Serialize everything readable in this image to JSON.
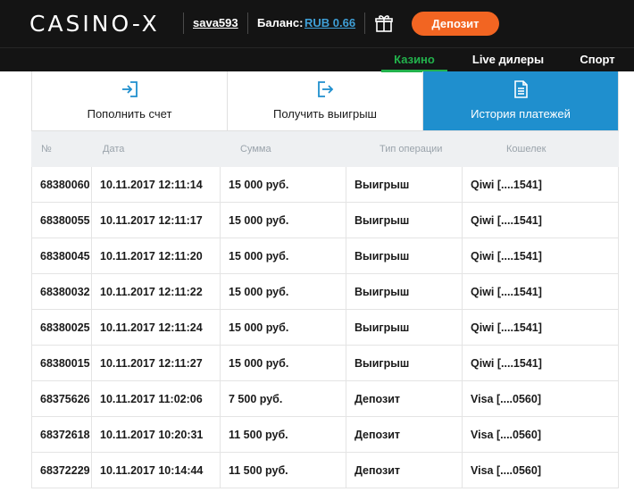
{
  "header": {
    "logo": "CASINO-X",
    "username": "sava593",
    "balance_label": "Баланс:",
    "balance_value": "RUB 0.66",
    "deposit_label": "Депозит"
  },
  "nav": [
    {
      "label": "Казино",
      "active": true
    },
    {
      "label": "Live дилеры",
      "active": false
    },
    {
      "label": "Спорт",
      "active": false
    }
  ],
  "actions": [
    {
      "label": "Пополнить счет",
      "icon": "login-icon",
      "active": false
    },
    {
      "label": "Получить выигрыш",
      "icon": "logout-icon",
      "active": false
    },
    {
      "label": "История платежей",
      "icon": "document-icon",
      "active": true
    }
  ],
  "table": {
    "headers": [
      "№",
      "Дата",
      "Сумма",
      "Тип операции",
      "Кошелек"
    ],
    "rows": [
      [
        "68380060",
        "10.11.2017 12:11:14",
        "15 000 руб.",
        "Выигрыш",
        "Qiwi [....1541]"
      ],
      [
        "68380055",
        "10.11.2017 12:11:17",
        "15 000 руб.",
        "Выигрыш",
        "Qiwi [....1541]"
      ],
      [
        "68380045",
        "10.11.2017 12:11:20",
        "15 000 руб.",
        "Выигрыш",
        "Qiwi [....1541]"
      ],
      [
        "68380032",
        "10.11.2017 12:11:22",
        "15 000 руб.",
        "Выигрыш",
        "Qiwi [....1541]"
      ],
      [
        "68380025",
        "10.11.2017 12:11:24",
        "15 000 руб.",
        "Выигрыш",
        "Qiwi [....1541]"
      ],
      [
        "68380015",
        "10.11.2017 12:11:27",
        "15 000 руб.",
        "Выигрыш",
        "Qiwi [....1541]"
      ],
      [
        "68375626",
        "10.11.2017 11:02:06",
        "7 500 руб.",
        "Депозит",
        "Visa [....0560]"
      ],
      [
        "68372618",
        "10.11.2017 10:20:31",
        "11 500 руб.",
        "Депозит",
        "Visa [....0560]"
      ],
      [
        "68372229",
        "10.11.2017 10:14:44",
        "11 500 руб.",
        "Депозит",
        "Visa [....0560]"
      ]
    ]
  },
  "colors": {
    "topbar": "#141414",
    "accent_orange": "#f26522",
    "accent_green": "#22b24c",
    "accent_blue": "#1f8fce",
    "link_blue": "#3fa0d8"
  }
}
